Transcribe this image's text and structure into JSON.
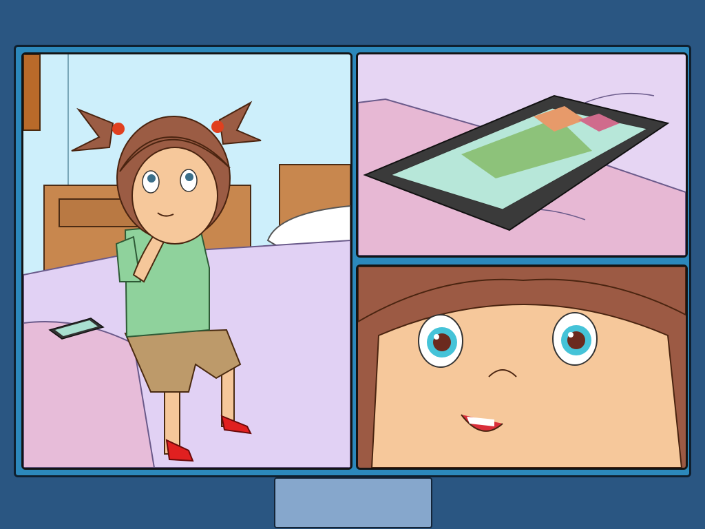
{
  "story": {
    "panels": [
      {
        "scene": "girl-thinking-on-bed"
      },
      {
        "scene": "tablet-on-bed"
      },
      {
        "scene": "girl-face-closeup"
      }
    ]
  },
  "navigation": {
    "button_label": ""
  },
  "colors": {
    "background": "#2a5682",
    "frame": "#2c88bb",
    "button": "#86a7cc"
  }
}
